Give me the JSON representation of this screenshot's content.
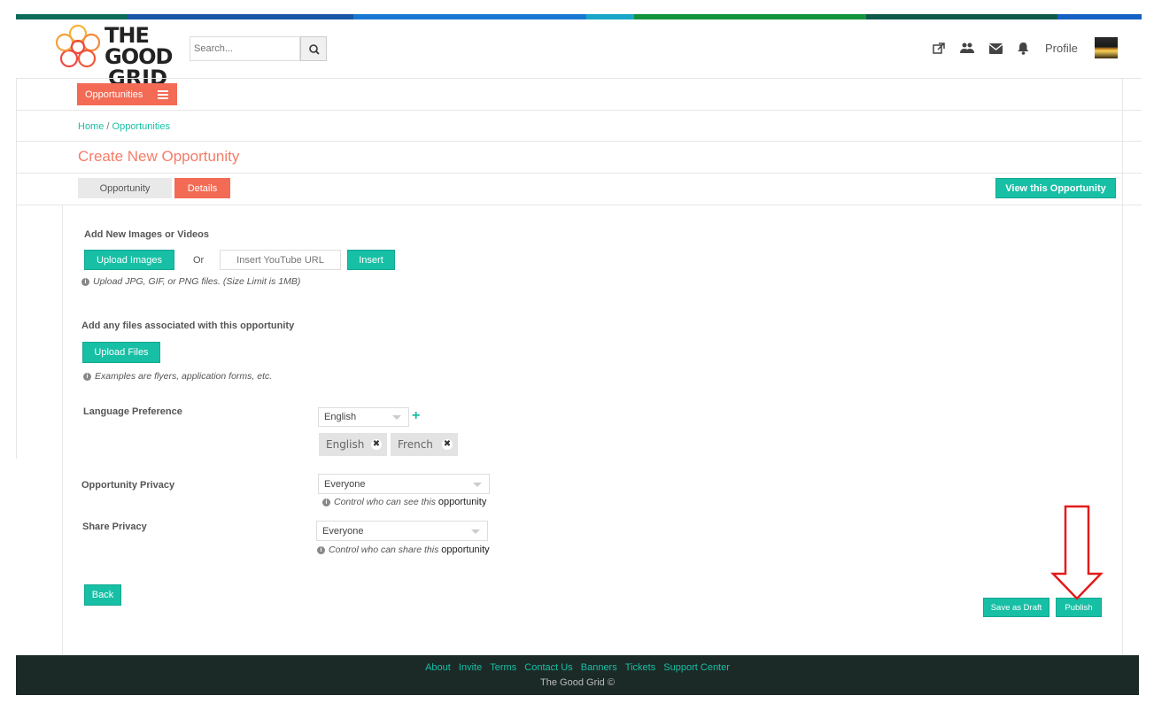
{
  "brand": {
    "logo_text_line1": "THE GOOD",
    "logo_text_line2": "GRID"
  },
  "header": {
    "search_placeholder": "Search...",
    "profile_label": "Profile"
  },
  "nav": {
    "opportunities_label": "Opportunities"
  },
  "breadcrumb": {
    "home": "Home",
    "separator": " / ",
    "current": "Opportunities"
  },
  "page_title": "Create New Opportunity",
  "tabs": [
    {
      "label": "Opportunity"
    },
    {
      "label": "Details"
    }
  ],
  "view_button": "View this Opportunity",
  "media": {
    "heading": "Add New Images or Videos",
    "upload_images": "Upload Images",
    "or": "Or",
    "youtube_placeholder": "Insert YouTube URL",
    "insert": "Insert",
    "hint": "Upload JPG, GIF, or PNG files.  (Size Limit is 1MB)"
  },
  "files": {
    "heading": "Add any files associated with this opportunity",
    "upload_files": "Upload Files",
    "hint": "Examples are flyers, application forms, etc."
  },
  "language": {
    "label": "Language Preference",
    "selected": "English",
    "tags": [
      "English",
      "French"
    ]
  },
  "opportunity_privacy": {
    "label": "Opportunity Privacy",
    "selected": "Everyone",
    "hint_italic": "Control who can see this",
    "hint_plain": "opportunity"
  },
  "share_privacy": {
    "label": "Share Privacy",
    "selected": "Everyone",
    "hint_italic": "Control who can share this",
    "hint_plain": "opportunity"
  },
  "actions": {
    "back": "Back",
    "save_draft": "Save as Draft",
    "publish": "Publish"
  },
  "footer": {
    "links": [
      "About",
      "Invite",
      "Terms",
      "Contact Us",
      "Banners",
      "Tickets",
      "Support Center"
    ],
    "copyright": "The Good Grid ©"
  },
  "colors": {
    "teal": "#17bfa5",
    "coral": "#f36a55",
    "title": "#f47d69",
    "footer_bg": "#1c2a27",
    "arrow": "#e31b1b"
  }
}
